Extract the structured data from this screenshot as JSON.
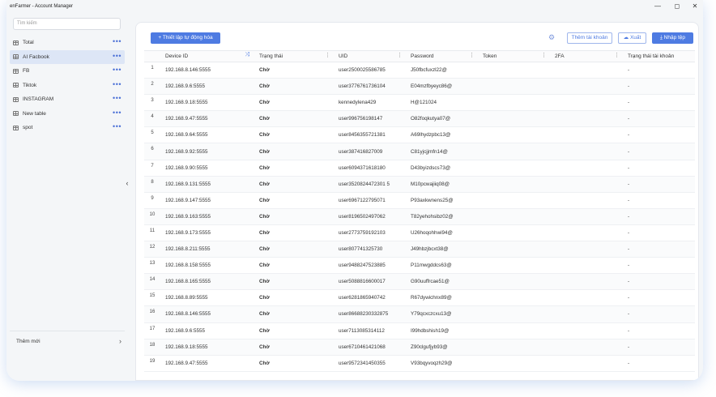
{
  "window": {
    "title": "enFarmer - Account Manager",
    "controls": [
      "—",
      "◻",
      "✕"
    ]
  },
  "sidebar": {
    "search_placeholder": "Tìm kiếm",
    "items": [
      {
        "label": "Total",
        "active": false
      },
      {
        "label": "AI Facbook",
        "active": true
      },
      {
        "label": "FB",
        "active": false
      },
      {
        "label": "Tiktok",
        "active": false
      },
      {
        "label": "INSTAGRAM",
        "active": false
      },
      {
        "label": "New table",
        "active": false
      },
      {
        "label": "spot",
        "active": false
      }
    ],
    "add_new_label": "Thêm mới"
  },
  "toolbar": {
    "auto_setup_label": "Thiết lập tự động hóa",
    "add_account_label": "Thêm tài khoản",
    "export_label": "Xuất",
    "import_label": "Nhập tệp"
  },
  "table": {
    "columns": [
      "Device ID",
      "Trạng thái",
      "UID",
      "Password",
      "Token",
      "2FA",
      "Trạng thái tài khoản"
    ],
    "rows": [
      {
        "n": "1",
        "device": "192.168.8.146:5555",
        "status": "Chờ",
        "uid": "user2500025586785",
        "password": "J50fbcfuxzl22@",
        "token": "",
        "twofa": "",
        "acct_status": "-"
      },
      {
        "n": "2",
        "device": "192.168.9.6:5555",
        "status": "Chờ",
        "uid": "user3776761736104",
        "password": "E04mzfbyeyc86@",
        "token": "",
        "twofa": "",
        "acct_status": "-"
      },
      {
        "n": "3",
        "device": "192.168.9.18:5555",
        "status": "Chờ",
        "uid": "kennedylena429",
        "password": "H@121024",
        "token": "",
        "twofa": "",
        "acct_status": "-"
      },
      {
        "n": "4",
        "device": "192.168.9.47:5555",
        "status": "Chờ",
        "uid": "user996756198147",
        "password": "O82foqkutya07@",
        "token": "",
        "twofa": "",
        "acct_status": "-"
      },
      {
        "n": "5",
        "device": "192.168.9.64:5555",
        "status": "Chờ",
        "uid": "user8456355721381",
        "password": "A69lhydzpbc13@",
        "token": "",
        "twofa": "",
        "acct_status": "-"
      },
      {
        "n": "6",
        "device": "192.168.9.92:5555",
        "status": "Chờ",
        "uid": "user387416827009",
        "password": "C81yjcjjmfn14@",
        "token": "",
        "twofa": "",
        "acct_status": "-"
      },
      {
        "n": "7",
        "device": "192.168.9.90:5555",
        "status": "Chờ",
        "uid": "user6094371618180",
        "password": "D43byizdscs73@",
        "token": "",
        "twofa": "",
        "acct_status": "-"
      },
      {
        "n": "8",
        "device": "192.168.9.131:5555",
        "status": "Chờ",
        "uid": "user3520824472301 5",
        "password": "M10pcwajiiq08@",
        "token": "",
        "twofa": "",
        "acct_status": "-"
      },
      {
        "n": "9",
        "device": "192.168.9.147:5555",
        "status": "Chờ",
        "uid": "user6967122795071",
        "password": "P93axkwnens25@",
        "token": "",
        "twofa": "",
        "acct_status": "-"
      },
      {
        "n": "10",
        "device": "192.168.9.163:5555",
        "status": "Chờ",
        "uid": "user8196502497062",
        "password": "T82yehohsibz02@",
        "token": "",
        "twofa": "",
        "acct_status": "-"
      },
      {
        "n": "11",
        "device": "192.168.9.173:5555",
        "status": "Chờ",
        "uid": "user2773759192103",
        "password": "U26hoqohhwi94@",
        "token": "",
        "twofa": "",
        "acct_status": "-"
      },
      {
        "n": "12",
        "device": "192.168.8.211:5555",
        "status": "Chờ",
        "uid": "user807741325730",
        "password": "J49hbzjbcxt38@",
        "token": "",
        "twofa": "",
        "acct_status": "-"
      },
      {
        "n": "13",
        "device": "192.168.8.158:5555",
        "status": "Chờ",
        "uid": "user9488247523885",
        "password": "P11mwgddcs63@",
        "token": "",
        "twofa": "",
        "acct_status": "-"
      },
      {
        "n": "14",
        "device": "192.168.8.165:5555",
        "status": "Chờ",
        "uid": "user5088816600017",
        "password": "G90uuffrcae51@",
        "token": "",
        "twofa": "",
        "acct_status": "-"
      },
      {
        "n": "15",
        "device": "192.168.8.89:5555",
        "status": "Chờ",
        "uid": "user6281865940742",
        "password": "R67dywichnx89@",
        "token": "",
        "twofa": "",
        "acct_status": "-"
      },
      {
        "n": "16",
        "device": "192.168.8.146:5555",
        "status": "Chờ",
        "uid": "user86688230332875",
        "password": "Y79qcxczcxu13@",
        "token": "",
        "twofa": "",
        "acct_status": "-"
      },
      {
        "n": "17",
        "device": "192.168.9.6:5555",
        "status": "Chờ",
        "uid": "user7113085314112",
        "password": "I99hdbshish19@",
        "token": "",
        "twofa": "",
        "acct_status": "-"
      },
      {
        "n": "18",
        "device": "192.168.9.18:5555",
        "status": "Chờ",
        "uid": "user6710461421068",
        "password": "Z90clgufjyb93@",
        "token": "",
        "twofa": "",
        "acct_status": "-"
      },
      {
        "n": "19",
        "device": "192.168.9.47:5555",
        "status": "Chờ",
        "uid": "user9572341450355",
        "password": "V93bqyvoqzh29@",
        "token": "",
        "twofa": "",
        "acct_status": "-"
      }
    ]
  },
  "colors": {
    "accent": "#4e7be2",
    "active_nav": "#dde6f6",
    "shadow": "#78a0dc"
  },
  "icons": {
    "nav_item": "table-icon",
    "more": "more-dots-icon",
    "auto_setup": "plus-icon",
    "settings": "gear-icon",
    "export": "cloud-icon",
    "import": "download-icon",
    "sort": "shuffle-icon",
    "column_menu": "column-menu-icon",
    "collapse": "chevron-left-icon",
    "add_new": "chevron-right-icon"
  }
}
